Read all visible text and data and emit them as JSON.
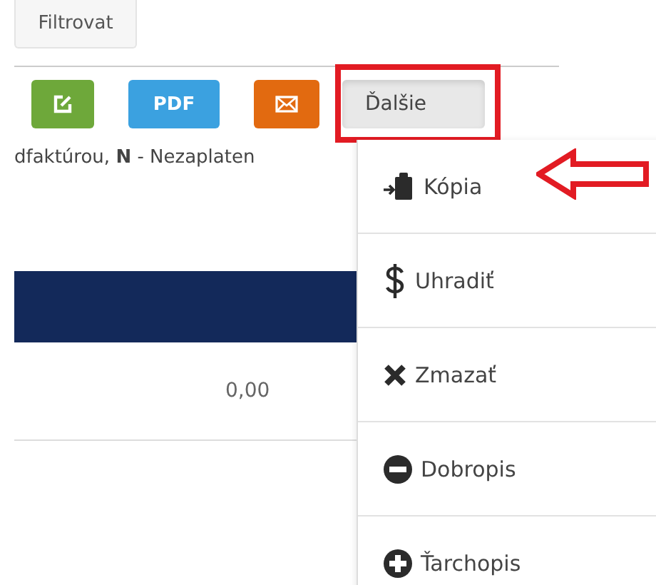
{
  "filter_button": {
    "label": "Filtrovat"
  },
  "toolbar": [
    {
      "kind": "edit"
    },
    {
      "kind": "pdf",
      "label": "PDF"
    },
    {
      "kind": "email"
    },
    {
      "kind": "more",
      "label": "Ďalšie",
      "expanded": true
    }
  ],
  "legend": "dfaktúrou, **N** - Nezaplaten",
  "table": {
    "rows": [
      {
        "amount": "0,00"
      }
    ]
  },
  "menu": [
    {
      "kind": "copy",
      "label": "Kópia"
    },
    {
      "kind": "pay",
      "label": "Uhradiť"
    },
    {
      "kind": "delete",
      "label": "Zmazať"
    },
    {
      "kind": "credit",
      "label": "Dobropis"
    },
    {
      "kind": "debit",
      "label": "Ťarchopis"
    }
  ]
}
